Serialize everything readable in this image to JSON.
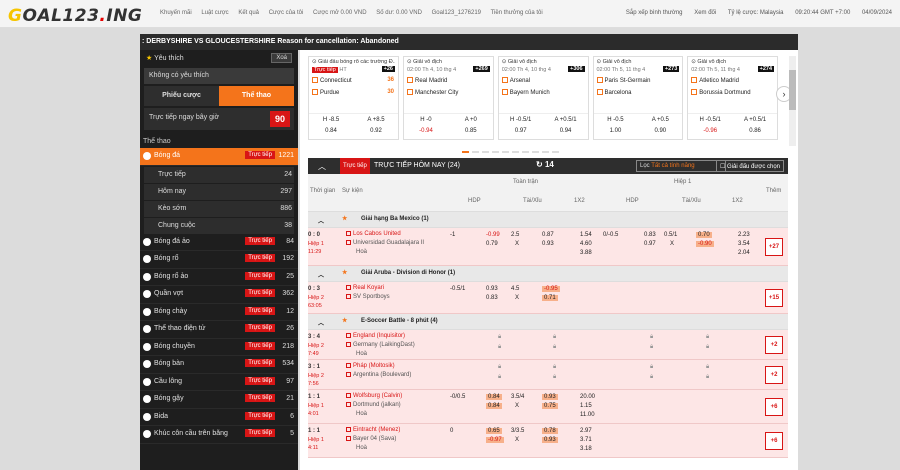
{
  "logo": {
    "g": "G",
    "main": "OAL123",
    "dot": ".",
    "tld": "ING"
  },
  "topnav": [
    "Khuyến mãi",
    "Luật cược",
    "Kết quả",
    "Cược của tôi",
    "Cược mở 0.00 VND",
    "Số dư: 0.00 VND",
    "Goal123_1276219",
    "Tiền thưởng của tôi"
  ],
  "topright": [
    "Sắp xếp bình thường",
    "Xem đối",
    "Tỷ lệ cược: Malaysia",
    "09:20:44 GMT +7:00",
    "04/09/2024"
  ],
  "ticker": ": DERBYSHIRE VS GLOUCESTERSHIRE Reason for cancellation: Abandoned",
  "sidebar": {
    "fav_label": "Yêu thích",
    "fav_clear": "Xoá",
    "no_fav": "Không có yêu thích",
    "tab1": "Phiếu cược",
    "tab2": "Thể thao",
    "live_today": "Trực tiếp ngay bây giờ",
    "live_count": "90",
    "sports_head": "Thể thao",
    "football": {
      "label": "Bóng đá",
      "tag": "Trực tiếp",
      "count": "1221"
    },
    "sub": [
      {
        "label": "Trực tiếp",
        "count": "24"
      },
      {
        "label": "Hôm nay",
        "count": "297"
      },
      {
        "label": "Kèo sớm",
        "count": "886"
      },
      {
        "label": "Chung cuộc",
        "count": "38"
      }
    ],
    "sports": [
      {
        "label": "Bóng đá ảo",
        "count": "84"
      },
      {
        "label": "Bóng rổ",
        "count": "192"
      },
      {
        "label": "Bóng rổ ảo",
        "count": "25"
      },
      {
        "label": "Quần vợt",
        "count": "362"
      },
      {
        "label": "Bóng chày",
        "count": "12"
      },
      {
        "label": "Thể thao điện tử",
        "count": "26"
      },
      {
        "label": "Bóng chuyền",
        "count": "218"
      },
      {
        "label": "Bóng bàn",
        "count": "534"
      },
      {
        "label": "Cầu lông",
        "count": "97"
      },
      {
        "label": "Bóng gậy",
        "count": "21"
      },
      {
        "label": "Bida",
        "count": "6"
      },
      {
        "label": "Khúc côn cầu trên băng",
        "count": "5"
      }
    ],
    "live_tag": "Trực tiếp"
  },
  "cards": [
    {
      "league": "Giải đấu bóng rổ các trường Đ...",
      "status": "HT",
      "live": "Trực tiếp",
      "badge": "+26",
      "home": "Connecticut",
      "away": "Purdue",
      "hs": "36",
      "as": "30",
      "h": "H -8.5",
      "hv": "0.84",
      "a": "A +8.5",
      "av": "0.92",
      "hred": false,
      "ared": false
    },
    {
      "league": "Giải vô địch",
      "status": "02:00 Th 4, 10 thg 4",
      "live": "",
      "badge": "+269",
      "home": "Real Madrid",
      "away": "Manchester City",
      "hs": "",
      "as": "",
      "h": "H -0",
      "hv": "-0.94",
      "a": "A +0",
      "av": "0.85",
      "hred": true,
      "ared": false
    },
    {
      "league": "Giải vô địch",
      "status": "02:00 Th 4, 10 thg 4",
      "live": "",
      "badge": "+306",
      "home": "Arsenal",
      "away": "Bayern Munich",
      "hs": "",
      "as": "",
      "h": "H -0.5/1",
      "hv": "0.97",
      "a": "A +0.5/1",
      "av": "0.94",
      "hred": false,
      "ared": false
    },
    {
      "league": "Giải vô địch",
      "status": "02:00 Th 5, 11 thg 4",
      "live": "",
      "badge": "+273",
      "home": "Paris St-Germain",
      "away": "Barcelona",
      "hs": "",
      "as": "",
      "h": "H -0.5",
      "hv": "1.00",
      "a": "A +0.5",
      "av": "0.90",
      "hred": false,
      "ared": false
    },
    {
      "league": "Giải vô địch",
      "status": "02:00 Th 5, 11 thg 4",
      "live": "",
      "badge": "+274",
      "home": "Atletico Madrid",
      "away": "Borussia Dortmund",
      "hs": "",
      "as": "",
      "h": "H -0.5/1",
      "hv": "-0.96",
      "a": "A +0.5/1",
      "av": "0.86",
      "hred": true,
      "ared": false
    }
  ],
  "bar": {
    "live_tag": "Trực tiếp",
    "title": "TRỰC TIẾP HÔM NAY (24)",
    "refresh": "14",
    "filter_label": "Lọc",
    "filter_value": "Tất cả tính năng",
    "select": "Giải đấu được chọn"
  },
  "thead": {
    "time": "Thời gian",
    "event": "Sự kiện",
    "full": "Toàn trận",
    "half": "Hiệp 1",
    "more": "Thêm",
    "hdp": "HDP",
    "ou": "Tài/Xỉu",
    "x12": "1X2"
  },
  "leagues": [
    {
      "name": "Giải hạng Ba Mexico (1)"
    },
    {
      "name": "Giải Aruba - Division di Honor (1)"
    },
    {
      "name": "E-Soccer Battle - 8 phút (4)"
    }
  ],
  "matches": [
    {
      "score": "0 : 0",
      "stat": "Hiệp 1",
      "stat2": "11:29",
      "home": "Los Cabos United",
      "away": "Universidad Guadalajara II",
      "draw": "Hoà",
      "f_hdp": "-1",
      "f_h1": "-0.99",
      "f_h2": "0.79",
      "f_ou": "2.5",
      "f_ou2": "X",
      "f_o1": "0.87",
      "f_o2": "0.93",
      "x1": "1.54",
      "x2": "4.60",
      "x3": "3.88",
      "h_hdp": "0/-0.5",
      "h_h1": "0.83",
      "h_h2": "0.97",
      "h_ou": "0.5/1",
      "h_ou2": "X",
      "h_o1": "0.70",
      "h_o2": "-0.90",
      "hx1": "2.23",
      "hx2": "3.54",
      "hx3": "2.04",
      "more": "+27"
    },
    {
      "score": "0 : 3",
      "stat": "Hiệp 2",
      "stat2": "63:05",
      "home": "Real Koyari",
      "away": "SV Sportboys",
      "draw": "",
      "f_hdp": "-0.5/1",
      "f_h1": "0.93",
      "f_h2": "0.83",
      "f_ou": "4.5",
      "f_ou2": "X",
      "f_o1": "-0.95",
      "f_o2": "0.71",
      "more": "+15"
    },
    {
      "score": "3 : 4",
      "stat": "Hiệp 2",
      "stat2": "7:49",
      "home": "England (Inquisitor)",
      "away": "Germany (LaikingDast)",
      "draw": "Hoà",
      "more": "+2"
    },
    {
      "score": "3 : 1",
      "stat": "Hiệp 2",
      "stat2": "7:56",
      "home": "Pháp (Moltosik)",
      "away": "Argentina (Boulevard)",
      "draw": "",
      "more": "+2"
    },
    {
      "score": "1 : 1",
      "stat": "Hiệp 1",
      "stat2": "4:01",
      "home": "Wolfsburg (Calvin)",
      "away": "Dortmund (jalkan)",
      "draw": "Hoà",
      "f_hdp": "-0/0.5",
      "f_h1": "0.84",
      "f_h2": "0.84",
      "f_ou": "3.5/4",
      "f_ou2": "X",
      "f_o1": "0.93",
      "f_o2": "0.75",
      "x1": "20.00",
      "x2": "1.15",
      "x3": "11.00",
      "more": "+6"
    },
    {
      "score": "1 : 1",
      "stat": "Hiệp 1",
      "stat2": "4:11",
      "home": "Eintracht (Menez)",
      "away": "Bayer 04 (Sava)",
      "draw": "Hoà",
      "f_hdp": "0",
      "f_h1": "0.65",
      "f_h2": "-0.97",
      "f_ou": "3/3.5",
      "f_ou2": "X",
      "f_o1": "0.78",
      "f_o2": "0.93",
      "x1": "2.97",
      "x2": "3.71",
      "x3": "3.18",
      "more": "+6"
    }
  ]
}
